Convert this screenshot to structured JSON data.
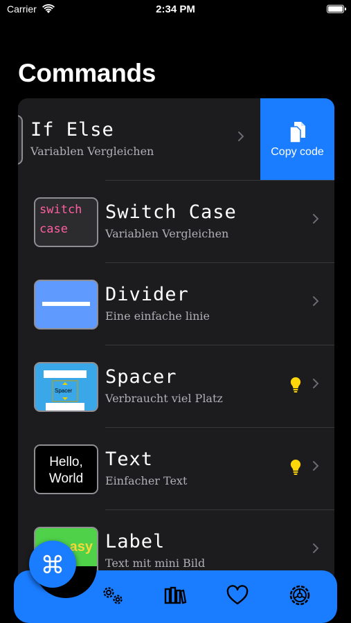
{
  "status": {
    "carrier": "Carrier",
    "time": "2:34 PM"
  },
  "page": {
    "title": "Commands"
  },
  "swipe_action": {
    "label": "Copy code",
    "icon": "copy-icon",
    "color": "#1a7cff"
  },
  "items": [
    {
      "title": "If Else",
      "subtitle": "Variablen Vergleichen"
    },
    {
      "title": "Switch Case",
      "subtitle": "Variablen Vergleichen",
      "thumb_line1": "switch",
      "thumb_line2": "case"
    },
    {
      "title": "Divider",
      "subtitle": "Eine einfache linie"
    },
    {
      "title": "Spacer",
      "subtitle": "Verbraucht viel Platz",
      "thumb_text": "Spacer",
      "tip": true
    },
    {
      "title": "Text",
      "subtitle": "Einfacher Text",
      "thumb_line1": "Hello,",
      "thumb_line2": "World",
      "tip": true
    },
    {
      "title": "Label",
      "subtitle": "Text mit mini Bild",
      "thumb_text": "asy"
    }
  ],
  "tabs": [
    {
      "icon": "command-icon",
      "active": true
    },
    {
      "icon": "gears-icon"
    },
    {
      "icon": "books-icon"
    },
    {
      "icon": "heart-icon"
    },
    {
      "icon": "settings-wheel-icon"
    }
  ],
  "colors": {
    "accent": "#1a7cff",
    "background": "#000000",
    "card": "#1c1c1e",
    "bulb": "#ffd60a"
  }
}
